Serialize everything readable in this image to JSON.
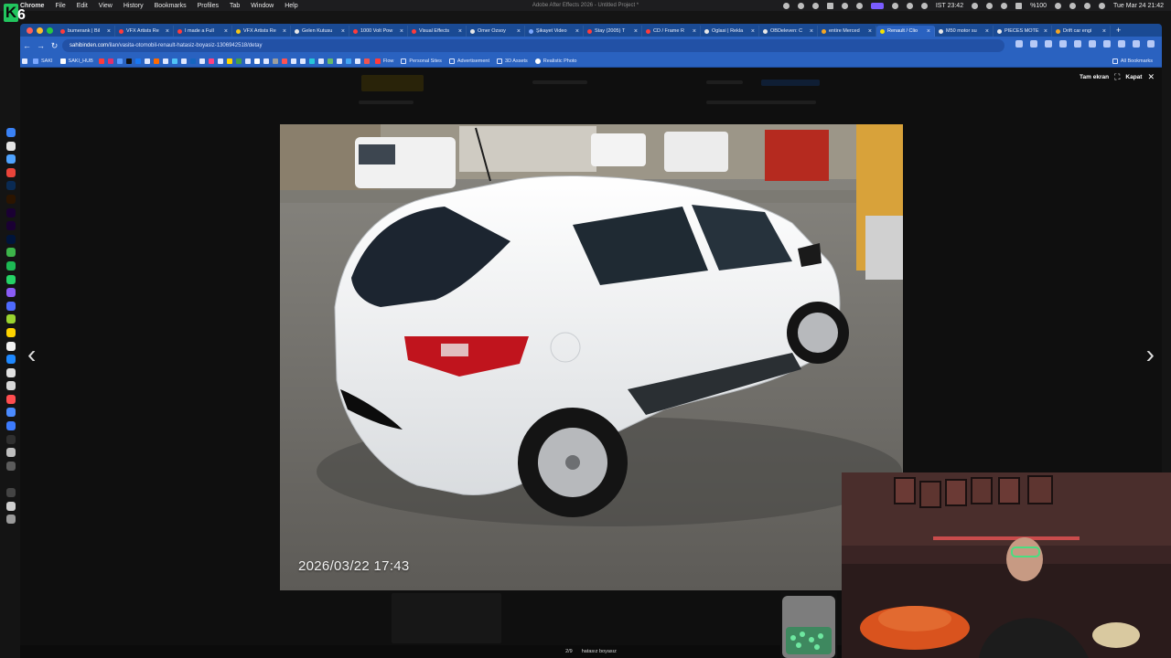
{
  "menubar": {
    "app": "Chrome",
    "items": [
      "File",
      "Edit",
      "View",
      "History",
      "Bookmarks",
      "Profiles",
      "Tab",
      "Window",
      "Help"
    ],
    "center_title": "Adobe After Effects 2026 - Untitled Project *",
    "timer": "IST 23:42",
    "battery": "%100",
    "datetime": "Tue Mar 24  21:42"
  },
  "logo": {
    "letter": "K",
    "number": "6"
  },
  "tabs": [
    {
      "title": "bumerank | Bil",
      "favicon": "#ff3b3b",
      "close": "×"
    },
    {
      "title": "VFX Artists Re",
      "favicon": "#ff3b3b",
      "close": "×"
    },
    {
      "title": "I made a Full",
      "favicon": "#ff3b3b",
      "close": "×"
    },
    {
      "title": "VFX Artists Re",
      "favicon": "#f5c518",
      "close": "×"
    },
    {
      "title": "Gelen Kutusu",
      "favicon": "#e8e8e8",
      "close": "×"
    },
    {
      "title": "1000 Volt Pow",
      "favicon": "#ff3b3b",
      "close": "×"
    },
    {
      "title": "Visual Effects",
      "favicon": "#ff3b3b",
      "close": "×"
    },
    {
      "title": "Omer Ozsoy",
      "favicon": "#e8e8e8",
      "close": "×"
    },
    {
      "title": "Şikayet Video",
      "favicon": "#7aa7ff",
      "close": "×"
    },
    {
      "title": "Stay (2005) T",
      "favicon": "#ff3b3b",
      "close": "×"
    },
    {
      "title": "CD / Frame R",
      "favicon": "#ff3b3b",
      "close": "×"
    },
    {
      "title": "Oglasi | Rekla",
      "favicon": "#e8e8e8",
      "close": "×"
    },
    {
      "title": "OBDeleven: C",
      "favicon": "#e8e8e8",
      "close": "×"
    },
    {
      "title": "entire Merced",
      "favicon": "#f5a623",
      "close": "×"
    },
    {
      "title": "Renault / Clio",
      "favicon": "#f5e300",
      "close": "×",
      "active": true
    },
    {
      "title": "M50 motor su",
      "favicon": "#e8e8e8",
      "close": "×"
    },
    {
      "title": "PIÈCES MOTE",
      "favicon": "#e8e8e8",
      "close": "×"
    },
    {
      "title": "Drift car engi",
      "favicon": "#f5a623",
      "close": "×"
    }
  ],
  "newtab": "+",
  "address": {
    "host": "sahibinden.com",
    "path": "/ilan/vasita-otomobil-renault-hatasiz-boyasiz-1306942518/detay"
  },
  "bookmarks": {
    "named": [
      "SAKI",
      "SAKI_HUB"
    ],
    "folders": [
      "Flow",
      "Personal Sites",
      "Advertisement",
      "3D Assets",
      "Realistic Photo"
    ],
    "all": "All Bookmarks"
  },
  "viewer": {
    "fullscreen_label": "Tam ekran",
    "close_label": "Kapat",
    "timestamp": "2026/03/22 17:43",
    "counter": "2/9",
    "caption": "hatasız boyasız",
    "prev_icon": "chevron-left-icon",
    "next_icon": "chevron-right-icon"
  },
  "colors": {
    "chrome_blue": "#2a62c0",
    "tab_strip": "#1a4a93",
    "logo_green": "#22c55e",
    "car_white": "#f4f5f6"
  }
}
